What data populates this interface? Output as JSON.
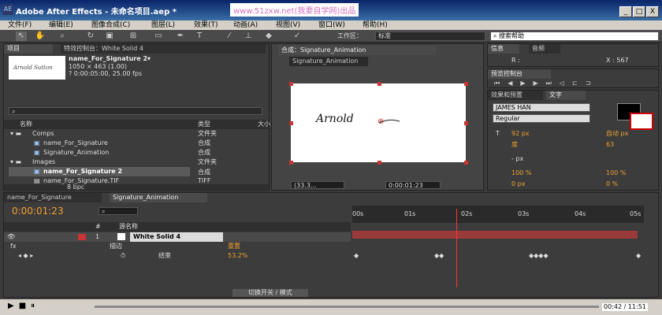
{
  "window": {
    "title": "Adobe After Effects - 未命名项目.aep *",
    "watermark": "www.51zxw.net(我要自学网)出品",
    "app_icon": "AE",
    "min_label": "_",
    "max_label": "□",
    "close_label": "X"
  },
  "menu": [
    "文件(F)",
    "编辑(E)",
    "图像合成(C)",
    "图层(L)",
    "效果(T)",
    "动画(A)",
    "视图(V)",
    "窗口(W)",
    "帮助(H)"
  ],
  "toolbar": {
    "workspace_label": "工作区：",
    "workspace_value": "标准",
    "search_label": "搜索帮助",
    "icons": [
      "selection-tool",
      "hand-tool",
      "zoom-tool",
      "rotate-tool",
      "camera-tool",
      "pan-behind-tool",
      "rectangle-tool",
      "pen-tool",
      "text-tool",
      "brush-tool",
      "clone-stamp-tool",
      "eraser-tool",
      "puppet-tool"
    ]
  },
  "project": {
    "tab_label": "项目",
    "effect_tab_label": "特效控制台：White Solid 4",
    "item_name": "name_For_Signature 2▾",
    "item_size": "1050 × 463 (1.00)",
    "item_duration": "? 0:00:05:00, 25.00 fps",
    "thumb_text": "Arnold Sutton",
    "columns": [
      "名称",
      "类型",
      "大小"
    ],
    "rows": [
      {
        "name": "Comps",
        "type": "文件夹",
        "indent": 0
      },
      {
        "name": "name_For_Signature",
        "type": "合成",
        "indent": 1
      },
      {
        "name": "Signature_Animation",
        "type": "合成",
        "indent": 1
      },
      {
        "name": "Images",
        "type": "文件夹",
        "indent": 0
      },
      {
        "name": "name_For_Signature 2",
        "type": "合成",
        "indent": 1
      },
      {
        "name": "name_For_Signature.TIF",
        "type": "TIFF",
        "indent": 1
      }
    ],
    "bpc": "8 bpc"
  },
  "composition": {
    "tab_label": "合成：Signature_Animation",
    "sub_tab": "Signature_Animation",
    "signature_text": "Arnold",
    "zoom": "(33.3...",
    "timecode": "0:00:01:23"
  },
  "info": {
    "tab_info": "信息",
    "tab_audio": "音频",
    "r_label": "R :",
    "x_label": "X : 567"
  },
  "preview": {
    "tab": "预览控制台"
  },
  "text_panel": {
    "tab_effects": "效果和预置",
    "tab_text": "文字",
    "font": "JAMES HAN",
    "style": "Regular",
    "size": "92 px",
    "leading": "自动 px",
    "kerning": "度",
    "tracking": "63",
    "stroke": "- px",
    "vscale": "100 %",
    "hscale": "100 %",
    "baseline": "0 px",
    "tsume": "0 %"
  },
  "timeline": {
    "tab1": "name_For_Signature",
    "tab2": "Signature_Animation",
    "timecode": "0:00:01:23",
    "ruler": [
      "00s",
      "01s",
      "02s",
      "03s",
      "04s",
      "05s"
    ],
    "col_headers": [
      "#",
      "源名称"
    ],
    "layer_num": "1",
    "layer_name": "White Solid 4",
    "effect_name": "描边",
    "effect_reset": "重置",
    "prop_name": "结束",
    "prop_value": "53.2%",
    "bottom_label": "切换开关 / 模式",
    "playhead_pct": 0.36
  },
  "taskbar": {
    "time": "00:42 / 11:51"
  }
}
